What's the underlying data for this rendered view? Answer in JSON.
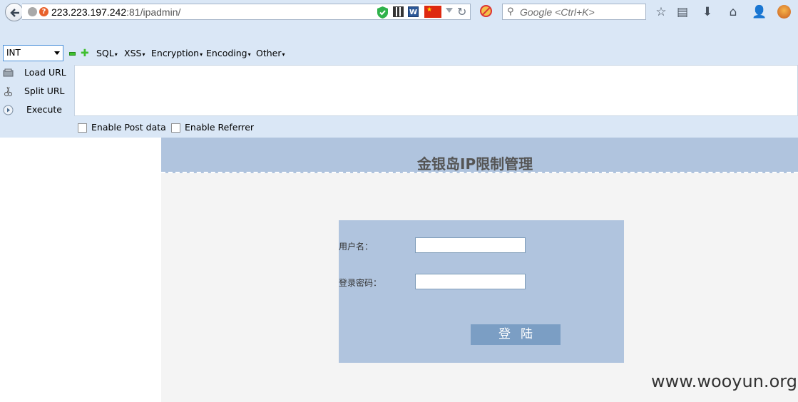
{
  "browser": {
    "url_host": "223.223.197.242",
    "url_rest": ":81/ipadmin/",
    "search_placeholder": "Google <Ctrl+K>",
    "word_icon_letter": "W"
  },
  "hackbar": {
    "select_value": "INT",
    "menus": [
      "SQL",
      "XSS",
      "Encryption",
      "Encoding",
      "Other"
    ],
    "buttons": [
      "Load URL",
      "Split URL",
      "Execute"
    ],
    "url_value": "",
    "checkboxes": [
      "Enable Post data",
      "Enable Referrer"
    ]
  },
  "page": {
    "title": "金银岛IP限制管理",
    "username_label": "用户名：",
    "password_label": "登录密码：",
    "login_button": "登陆",
    "username_value": "",
    "password_value": ""
  },
  "watermark": "www.wooyun.org",
  "colors": {
    "chrome_bg": "#dae7f6",
    "banner_bg": "#b0c4de",
    "login_button_bg": "#7b9ec4",
    "page_bg": "#f4f4f4"
  }
}
